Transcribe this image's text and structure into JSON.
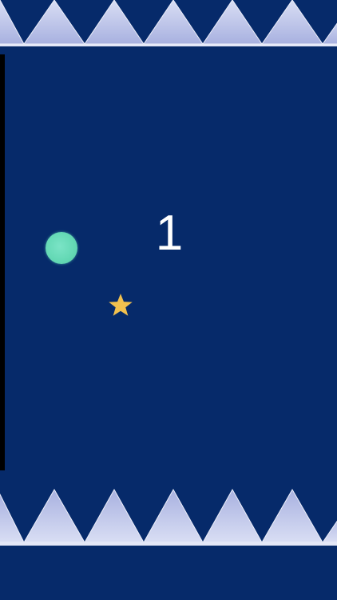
{
  "game": {
    "score": "1",
    "spike_color": "#b9c0e8",
    "background_color": "#062a6a"
  },
  "objects": {
    "player": "ball",
    "pickup": "star-icon"
  }
}
